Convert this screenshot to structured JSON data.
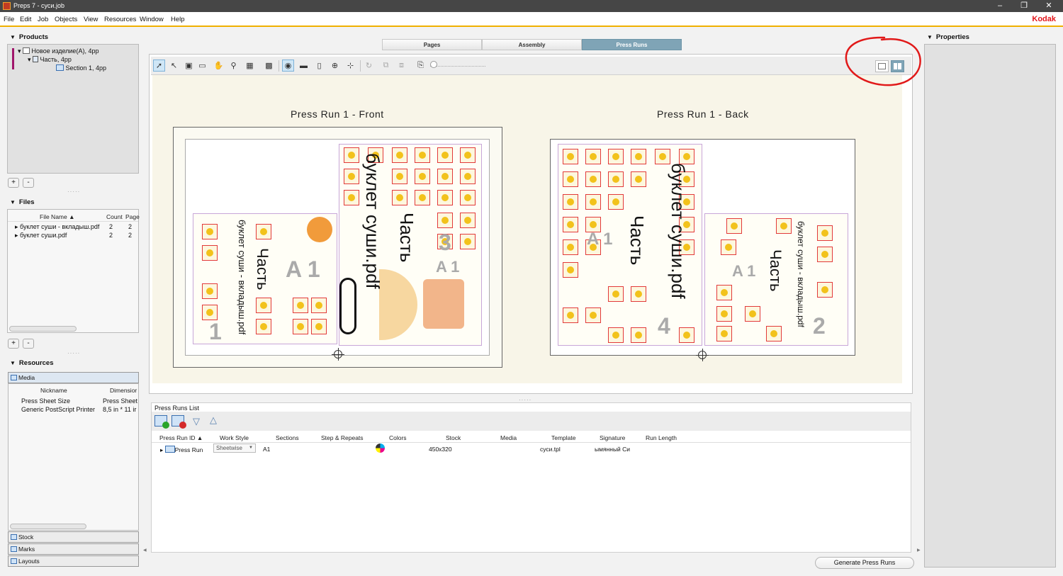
{
  "window": {
    "title": "Preps 7 - суси.job",
    "controls": [
      "‒",
      "❐",
      "✕"
    ]
  },
  "menu": {
    "items": [
      "File",
      "Edit",
      "Job",
      "Objects",
      "View",
      "Resources",
      "Window",
      "Help"
    ],
    "brand": "Kodak"
  },
  "products": {
    "title": "Products",
    "tree": [
      "Новое изделие(A), 4pp",
      "Часть, 4pp",
      "Section 1, 4pp"
    ],
    "add": "+",
    "remove": "-"
  },
  "files": {
    "title": "Files",
    "columns": [
      "File Name",
      "Count",
      "Page"
    ],
    "rows": [
      {
        "name": "буклет суши - вкладыш.pdf",
        "count": "2",
        "pages": "2"
      },
      {
        "name": "буклет суши.pdf",
        "count": "2",
        "pages": "2"
      }
    ],
    "add": "+",
    "remove": "-"
  },
  "resources": {
    "title": "Resources",
    "media_tab": "Media",
    "columns": [
      "Nickname",
      "Dimensior"
    ],
    "rows": [
      {
        "nickname": "Press Sheet Size",
        "dimension": "Press Sheet"
      },
      {
        "nickname": "Generic PostScript Printer",
        "dimension": "8,5 in * 11 ir"
      }
    ],
    "sections": [
      "Stock",
      "Marks",
      "Layouts"
    ]
  },
  "tabs": [
    "Pages",
    "Assembly",
    "Press Runs"
  ],
  "active_tab": "Press Runs",
  "canvas": {
    "front_label": "Press Run 1 - Front",
    "back_label": "Press Run 1 - Back",
    "front_texts": {
      "big1": "буклет суши.pdf",
      "big2": "Часть",
      "small1": "буклет суши - вкладыш.pdf",
      "small2": "Часть",
      "ghost1": "3",
      "ghost2": "1",
      "ghost3": "A 1"
    },
    "back_texts": {
      "big1": "буклет суши.pdf",
      "big2": "Часть",
      "small1": "буклет суши - вкладыш.pdf",
      "small2": "Часть",
      "ghost1": "4",
      "ghost2": "2",
      "ghost3": "A 1"
    }
  },
  "press_runs": {
    "title": "Press Runs List",
    "columns": [
      "Press Run ID",
      "Work Style",
      "Sections",
      "Step & Repeats",
      "Colors",
      "Stock",
      "Media",
      "Template",
      "Signature",
      "Run Length"
    ],
    "row": {
      "id": "Press Run",
      "work_style": "Sheetwise",
      "sections": "A1",
      "stock": "450x320",
      "template": "суси.tpl",
      "signature": "ымянный Си"
    }
  },
  "properties": {
    "title": "Properties"
  },
  "generate_label": "Generate Press Runs",
  "colors": {
    "accent": "#f0b000",
    "active_tab": "#7fa4b6",
    "brand": "#e3161b",
    "annotation": "#e11919"
  }
}
